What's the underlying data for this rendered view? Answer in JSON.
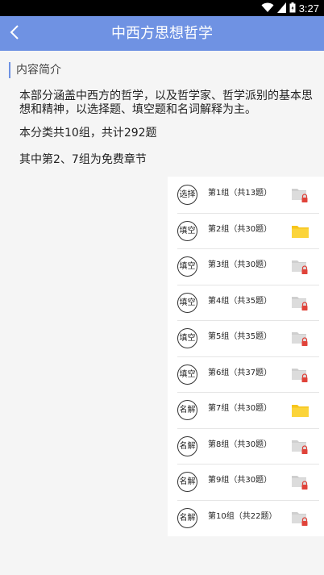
{
  "status": {
    "time": "3:27"
  },
  "header": {
    "title": "中西方思想哲学"
  },
  "intro": {
    "heading": "内容简介",
    "description": "本部分涵盖中西方的哲学，以及哲学家、哲学派别的基本思想和精神，以选择题、填空题和名词解释为主。",
    "summary": "本分类共10组，共计292题",
    "free_note": "其中第2、7组为免费章节"
  },
  "groups": [
    {
      "type": "选择",
      "label": "第1组（共13题）",
      "locked": true
    },
    {
      "type": "填空",
      "label": "第2组（共30题）",
      "locked": false
    },
    {
      "type": "填空",
      "label": "第3组（共30题）",
      "locked": true
    },
    {
      "type": "填空",
      "label": "第4组（共35题）",
      "locked": true
    },
    {
      "type": "填空",
      "label": "第5组（共35题）",
      "locked": true
    },
    {
      "type": "填空",
      "label": "第6组（共37题）",
      "locked": true
    },
    {
      "type": "名解",
      "label": "第7组（共30题）",
      "locked": false
    },
    {
      "type": "名解",
      "label": "第8组（共30题）",
      "locked": true
    },
    {
      "type": "名解",
      "label": "第9组（共30题）",
      "locked": true
    },
    {
      "type": "名解",
      "label": "第10组（共22题）",
      "locked": true
    }
  ],
  "colors": {
    "app_bar": "#6f92e3",
    "free_folder": "#f7c51b",
    "locked_folder": "#cfcfcf",
    "lock": "#e0433a"
  },
  "icons": {
    "back": "chevron-left-icon",
    "wifi": "wifi-icon",
    "signal": "signal-icon",
    "battery": "battery-icon",
    "free_folder": "folder-icon",
    "locked_folder": "locked-folder-icon"
  }
}
